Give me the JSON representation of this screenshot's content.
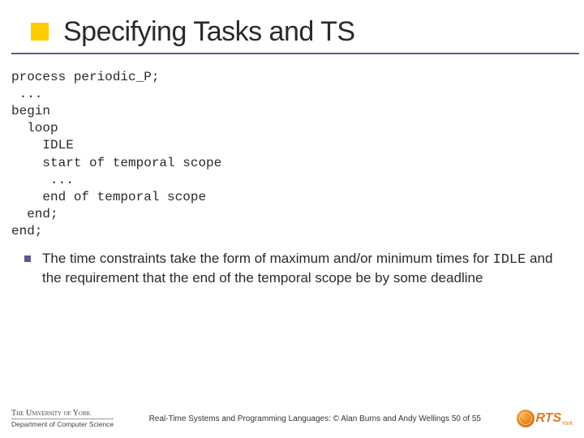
{
  "title": "Specifying Tasks and TS",
  "code": "process periodic_P;\n ...\nbegin\n  loop\n    IDLE\n    start of temporal scope\n     ...\n    end of temporal scope\n  end;\nend;",
  "bullet": {
    "pre": "The time constraints take the form of maximum and/or minimum times for ",
    "mono": "IDLE",
    "post": " and the requirement that the end of the temporal scope be by some deadline"
  },
  "footer": {
    "uni_top": "The University of York",
    "uni_bot": "Department of Computer Science",
    "credit": "Real-Time Systems and Programming Languages: © Alan Burns and Andy Wellings 50 of 55",
    "rts": "RTS",
    "rts_sub": "York"
  }
}
